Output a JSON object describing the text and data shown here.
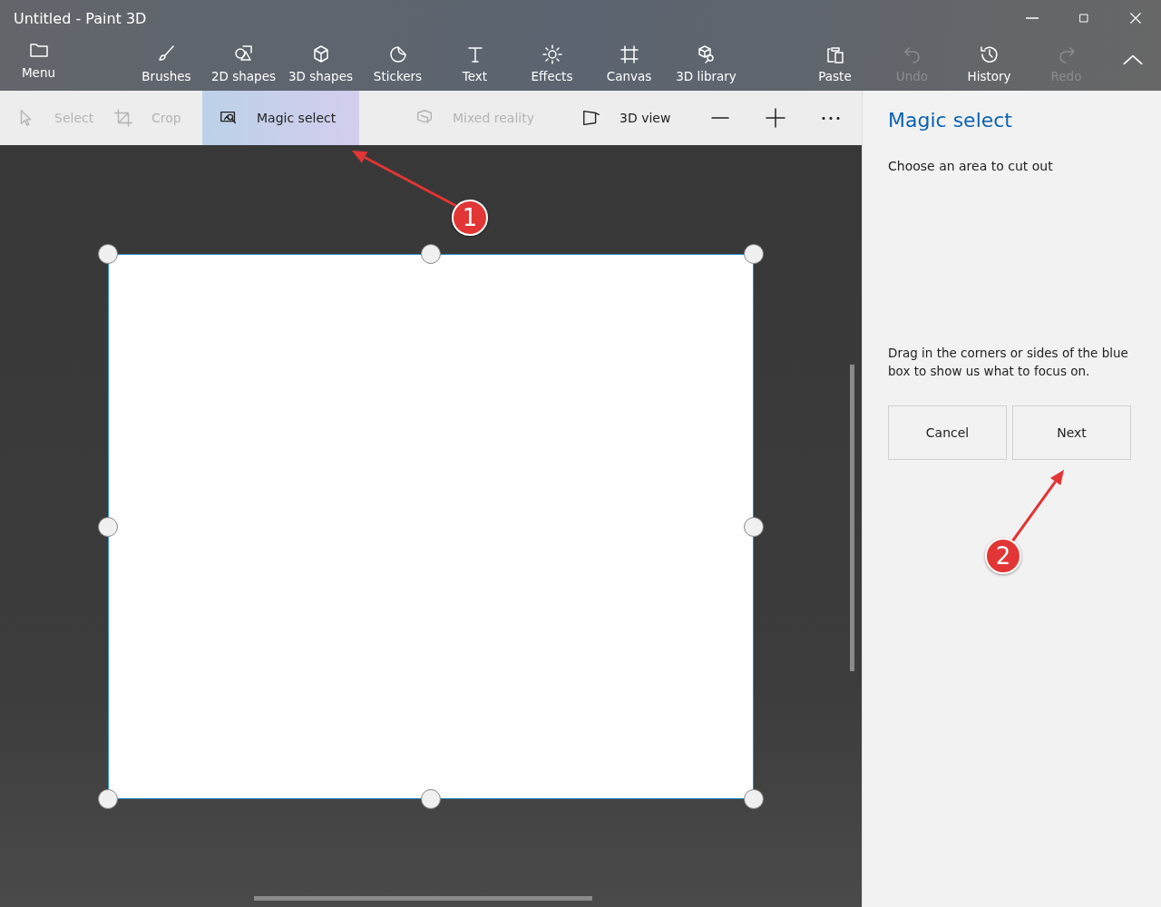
{
  "window": {
    "title": "Untitled - Paint 3D"
  },
  "toolbar": {
    "menu": {
      "label": "Menu"
    },
    "tools": [
      {
        "label": "Brushes",
        "kind": "brush"
      },
      {
        "label": "2D shapes",
        "kind": "shapes2d"
      },
      {
        "label": "3D shapes",
        "kind": "cube"
      },
      {
        "label": "Stickers",
        "kind": "sticker"
      },
      {
        "label": "Text",
        "kind": "text"
      },
      {
        "label": "Effects",
        "kind": "sun"
      },
      {
        "label": "Canvas",
        "kind": "canvas"
      },
      {
        "label": "3D library",
        "kind": "library"
      }
    ],
    "actions": [
      {
        "label": "Paste",
        "kind": "paste",
        "disabled": false
      },
      {
        "label": "Undo",
        "kind": "undo",
        "disabled": true
      },
      {
        "label": "History",
        "kind": "history",
        "disabled": false
      },
      {
        "label": "Redo",
        "kind": "redo",
        "disabled": true
      }
    ]
  },
  "subtoolbar": {
    "tools": [
      {
        "label": "Select",
        "kind": "pointer",
        "disabled": true,
        "selected": false
      },
      {
        "label": "Crop",
        "kind": "crop",
        "disabled": true,
        "selected": false
      },
      {
        "label": "Magic select",
        "kind": "magic",
        "disabled": false,
        "selected": true
      },
      {
        "label": "Mixed reality",
        "kind": "mixed",
        "disabled": true,
        "selected": false
      },
      {
        "label": "3D view",
        "kind": "view3d",
        "disabled": false,
        "selected": false
      }
    ],
    "zoom": [
      {
        "kind": "minus"
      },
      {
        "kind": "plus"
      },
      {
        "kind": "more"
      }
    ]
  },
  "panel": {
    "title": "Magic select",
    "instruction": "Choose an area to cut out",
    "hint": "Drag in the corners or sides of the blue box to show us what to focus on.",
    "buttons": [
      "Cancel",
      "Next"
    ]
  },
  "annotations": [
    {
      "label": "1"
    },
    {
      "label": "2"
    }
  ]
}
